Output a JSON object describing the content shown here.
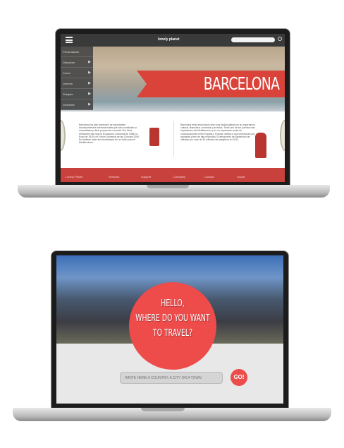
{
  "laptop1": {
    "logo": "lonely planet",
    "search_placeholder": "",
    "menu": [
      {
        "label": "Presentación"
      },
      {
        "label": "Descubre"
      },
      {
        "label": "Come"
      },
      {
        "label": "Duerme"
      },
      {
        "label": "Relájate"
      },
      {
        "label": "Diviértete"
      }
    ],
    "banner": "BARCELONA",
    "text_left": "Barcelona ha sido escenario de importantes acontecimientos internacionales que han contribuido a consolidarla y darle proyección mundial. Sus hitos relevantes han sido la Exposición Universal de 1888, la Expo de 1929 y el Fórum Universal de las Culturas 2004. Es también sede del secretariado de la Unión para el Mediterráneo.",
    "text_right": "Barcelona está reconocida como una ciudad global por su importancia cultural, financiera, comercial y turística. Tiene uno de los puertos más importantes del Mediterráneo y es un importante punto de comunicaciones entre España y Francia, debido a sus conexiones por autopista y tren de alta velocidad. El aeropuerto de Barcelona fue utilizado por más de 35 millones de pasajeros en 2013.",
    "footer": [
      "Lonely Planet",
      "Services",
      "Support",
      "Company",
      "Contact",
      "Social"
    ],
    "colors": {
      "accent": "#d9433a",
      "footer": "#c9413d"
    }
  },
  "laptop2": {
    "headline": [
      "HELLO,",
      "WHERE DO YOU WANT",
      "TO TRAVEL?"
    ],
    "search_placeholder": "WRITE HERE A COUNTRY, A CITY OR A TOWN",
    "go_label": "GO!",
    "colors": {
      "accent": "#ee4b4b"
    }
  }
}
